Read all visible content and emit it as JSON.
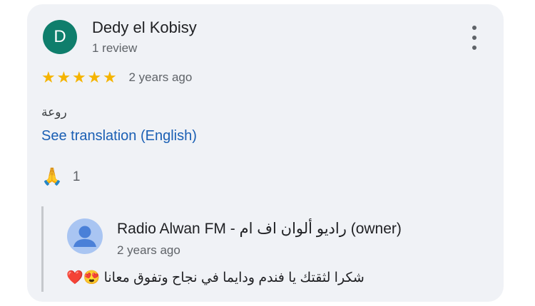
{
  "review": {
    "avatar_letter": "D",
    "author_name": "Dedy el Kobisy",
    "author_review_count": "1 review",
    "rating": 5,
    "rating_max": 5,
    "time_ago": "2 years ago",
    "text": "روعة",
    "translate_link": "See translation (English)",
    "reaction_emoji": "🙏",
    "reaction_count": "1"
  },
  "owner_reply": {
    "name": "Radio Alwan FM - راديو ألوان اف ام (owner)",
    "time_ago": "2 years ago",
    "text": "شكرا لثقتك يا فندم ودايما في نجاح وتفوق معانا 😍❤️"
  },
  "colors": {
    "avatar_bg": "#0f7e6c",
    "star": "#f5b400",
    "link": "#1a5fb4",
    "card_bg": "#f0f2f6"
  }
}
